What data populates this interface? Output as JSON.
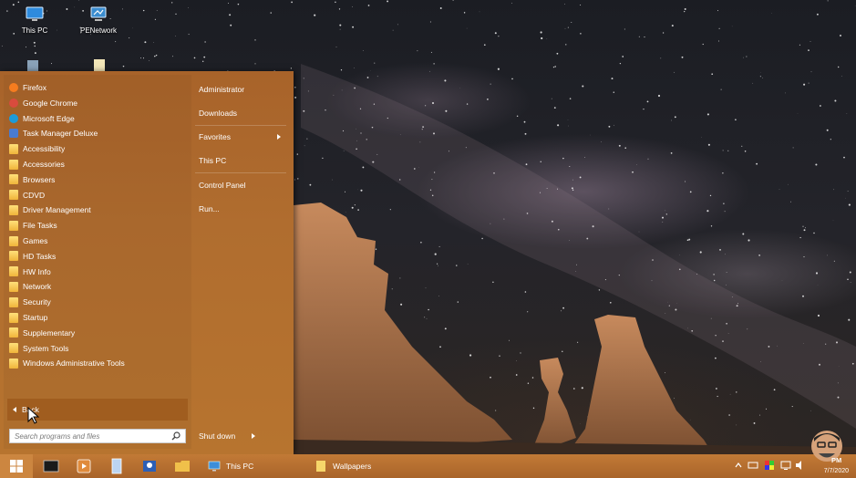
{
  "desktop": {
    "icons": [
      {
        "label": "This PC",
        "icon": "computer-icon"
      },
      {
        "label": "PENetwork",
        "icon": "network-icon"
      }
    ]
  },
  "start_menu": {
    "programs": [
      {
        "label": "Firefox",
        "icon": "firefox-icon"
      },
      {
        "label": "Google Chrome",
        "icon": "chrome-icon"
      },
      {
        "label": "Microsoft Edge",
        "icon": "edge-icon"
      },
      {
        "label": "Task Manager Deluxe",
        "icon": "task-manager-icon"
      },
      {
        "label": "Accessibility",
        "icon": "folder-icon"
      },
      {
        "label": "Accessories",
        "icon": "folder-icon"
      },
      {
        "label": "Browsers",
        "icon": "folder-icon"
      },
      {
        "label": "CDVD",
        "icon": "folder-icon"
      },
      {
        "label": "Driver Management",
        "icon": "folder-icon"
      },
      {
        "label": "File Tasks",
        "icon": "folder-icon"
      },
      {
        "label": "Games",
        "icon": "folder-icon"
      },
      {
        "label": "HD Tasks",
        "icon": "folder-icon"
      },
      {
        "label": "HW Info",
        "icon": "folder-icon"
      },
      {
        "label": "Network",
        "icon": "folder-icon"
      },
      {
        "label": "Security",
        "icon": "folder-icon"
      },
      {
        "label": "Startup",
        "icon": "folder-icon"
      },
      {
        "label": "Supplementary",
        "icon": "folder-icon"
      },
      {
        "label": "System Tools",
        "icon": "folder-icon"
      },
      {
        "label": "Windows Administrative Tools",
        "icon": "folder-icon"
      }
    ],
    "back_label": "Back",
    "search_placeholder": "Search programs and files",
    "right_items": [
      {
        "label": "Administrator",
        "has_submenu": false
      },
      {
        "label": "Downloads",
        "has_submenu": false
      },
      {
        "label": "Favorites",
        "has_submenu": true
      },
      {
        "label": "This PC",
        "has_submenu": false
      },
      {
        "label": "Control Panel",
        "has_submenu": false
      },
      {
        "label": "Run...",
        "has_submenu": false
      }
    ],
    "shutdown_label": "Shut down"
  },
  "taskbar": {
    "pinned": [
      "terminal-icon",
      "media-player-icon",
      "notepad-icon",
      "users-icon",
      "file-explorer-icon"
    ],
    "windows": [
      {
        "label": "This PC",
        "icon": "computer-icon"
      },
      {
        "label": "Wallpapers",
        "icon": "folder-icon"
      }
    ],
    "tray": [
      "chevron-icon",
      "keyboard-icon",
      "color-icon",
      "display-icon",
      "network-icon",
      "volume-icon"
    ],
    "time_suffix": "PM",
    "date": "7/7/2020"
  },
  "colors": {
    "menu": "#b06d2f",
    "taskbar": "#b5702f",
    "accent": "#cc8640"
  }
}
